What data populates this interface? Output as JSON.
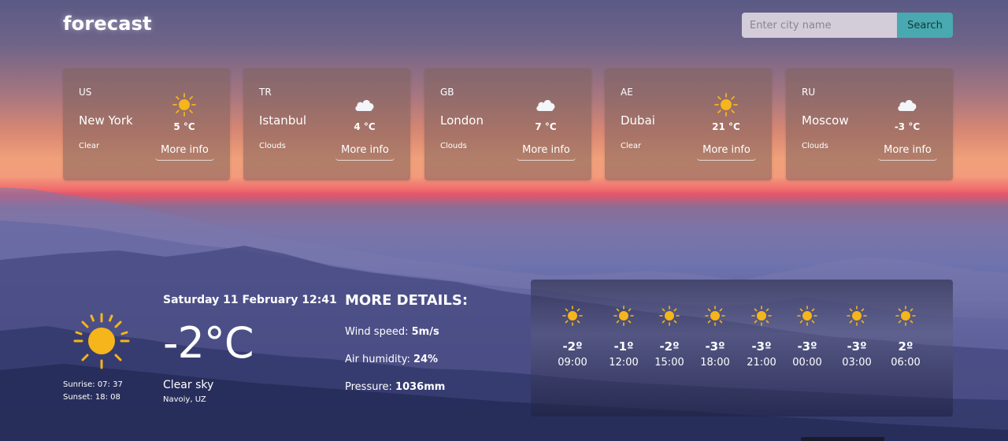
{
  "header": {
    "logo": "forecast",
    "search_placeholder": "Enter city name",
    "search_button": "Search"
  },
  "cities": [
    {
      "country": "US",
      "city": "New York",
      "condition": "Clear",
      "temp": "5 °C",
      "icon": "sun-icon",
      "more": "More info"
    },
    {
      "country": "TR",
      "city": "Istanbul",
      "condition": "Clouds",
      "temp": "4 °C",
      "icon": "cloud-icon",
      "more": "More info"
    },
    {
      "country": "GB",
      "city": "London",
      "condition": "Clouds",
      "temp": "7 °C",
      "icon": "cloud-icon",
      "more": "More info"
    },
    {
      "country": "AE",
      "city": "Dubai",
      "condition": "Clear",
      "temp": "21 °C",
      "icon": "sun-icon",
      "more": "More info"
    },
    {
      "country": "RU",
      "city": "Moscow",
      "condition": "Clouds",
      "temp": "-3 °C",
      "icon": "cloud-icon",
      "more": "More info"
    }
  ],
  "current": {
    "datetime": "Saturday 11 February 12:41",
    "temp": "-2°C",
    "description": "Clear sky",
    "location": "Navoiy, UZ",
    "sunrise": "Sunrise: 07: 37",
    "sunset": "Sunset: 18: 08",
    "icon": "sun-icon"
  },
  "details": {
    "title": "MORE DETAILS:",
    "wind_label": "Wind speed:",
    "wind_value": "5m/s",
    "humidity_label": "Air humidity:",
    "humidity_value": "24%",
    "pressure_label": "Pressure:",
    "pressure_value": "1036mm"
  },
  "hourly": [
    {
      "temp": "-2º",
      "time": "09:00",
      "icon": "sun-icon"
    },
    {
      "temp": "-1º",
      "time": "12:00",
      "icon": "sun-icon"
    },
    {
      "temp": "-2º",
      "time": "15:00",
      "icon": "sun-icon"
    },
    {
      "temp": "-3º",
      "time": "18:00",
      "icon": "sun-icon"
    },
    {
      "temp": "-3º",
      "time": "21:00",
      "icon": "sun-icon"
    },
    {
      "temp": "-3º",
      "time": "00:00",
      "icon": "sun-icon"
    },
    {
      "temp": "-3º",
      "time": "03:00",
      "icon": "sun-icon"
    },
    {
      "temp": "2º",
      "time": "06:00",
      "icon": "sun-icon"
    }
  ],
  "colors": {
    "accent": "#48aab0",
    "sun": "#f5b51b"
  }
}
